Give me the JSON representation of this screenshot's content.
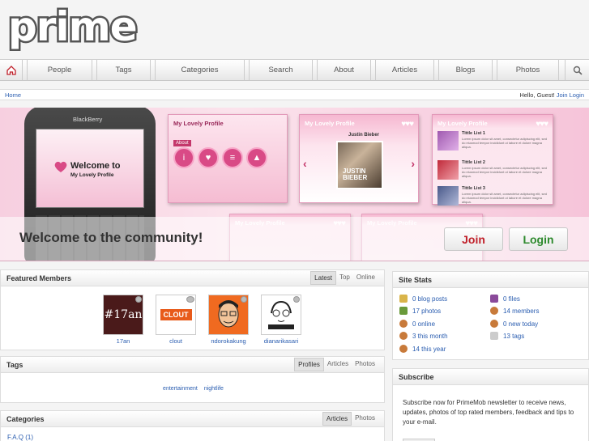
{
  "logo": {
    "text": "prime"
  },
  "nav": {
    "items": [
      "People",
      "Tags",
      "Categories",
      "Search",
      "About",
      "Articles",
      "Blogs",
      "Photos"
    ]
  },
  "breadcrumb": {
    "home": "Home",
    "greeting": "Hello, Guest!",
    "join": "Join",
    "login": "Login"
  },
  "banner": {
    "phone_brand": "BlackBerry",
    "phone_welcome": "Welcome to",
    "phone_sub": "My Lovely Profile",
    "card_title": "My Lovely Profile",
    "about_tab": "About",
    "card2_name": "Justin Bieber",
    "card2_photo_text": "JUSTIN BIEBER",
    "list_titles": [
      "Tittle List 1",
      "Tittle List 2",
      "Tittle List 3"
    ],
    "lorem": "Lorem ipsum dolor sit amet, consectetur adipiscing elit, sed do eiusmod tempor incididunt ut labore et dolore magna aliqua.",
    "welcome": "Welcome to the community!",
    "join": "Join",
    "login": "Login"
  },
  "featured": {
    "title": "Featured Members",
    "tabs": [
      "Latest",
      "Top",
      "Online"
    ],
    "members": [
      {
        "name": "17an",
        "avatar_text": "#17an"
      },
      {
        "name": "clout",
        "avatar_text": "CLOUT"
      },
      {
        "name": "ndorokakung",
        "avatar_text": ""
      },
      {
        "name": "dianarikasari",
        "avatar_text": ""
      }
    ]
  },
  "tags": {
    "title": "Tags",
    "tabs": [
      "Profiles",
      "Articles",
      "Photos"
    ],
    "items": [
      "entertainment",
      "nightlife"
    ]
  },
  "categories": {
    "title": "Categories",
    "tabs": [
      "Articles",
      "Photos"
    ],
    "first_item": "F.A.Q (1)"
  },
  "stats": {
    "title": "Site Stats",
    "left": [
      "0 blog posts",
      "17 photos",
      "0 online",
      "3 this month",
      "14 this year"
    ],
    "right": [
      "0 files",
      "14 members",
      "0 new today",
      "13 tags"
    ]
  },
  "subscribe": {
    "title": "Subscribe",
    "text": "Subscribe now for PrimeMob newsletter to receive news, updates, photos of top rated members, feedback and tips to your e-mail."
  },
  "colors": {
    "link": "#2a5db0",
    "join": "#c0202a",
    "login": "#2d8a2d",
    "banner": "#f7cfe0"
  }
}
